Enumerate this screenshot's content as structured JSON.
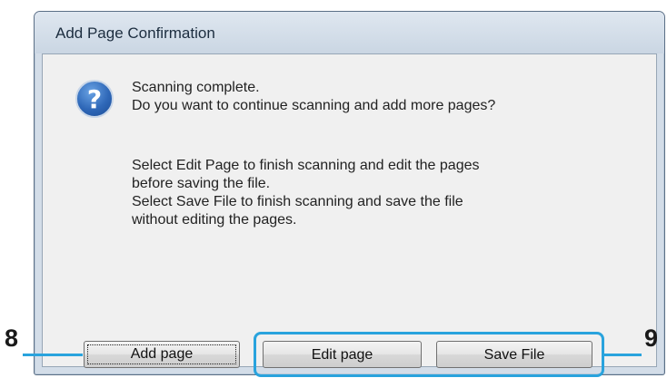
{
  "dialog": {
    "title": "Add Page Confirmation",
    "icon": "question-icon",
    "message_lines": [
      "Scanning complete.",
      "Do you want to continue scanning and add more pages?"
    ],
    "detail_lines": [
      "Select Edit Page to finish scanning and edit the pages",
      "before saving the file.",
      "Select Save File to finish scanning and save the file",
      "without editing the pages."
    ],
    "buttons": {
      "add_page": "Add page",
      "edit_page": "Edit page",
      "save_file": "Save File"
    }
  },
  "callouts": {
    "left": "8",
    "right": "9"
  },
  "colors": {
    "highlight": "#29a3dd",
    "dialog_frame": "#d3dde8",
    "client_bg": "#f0f0f0"
  }
}
